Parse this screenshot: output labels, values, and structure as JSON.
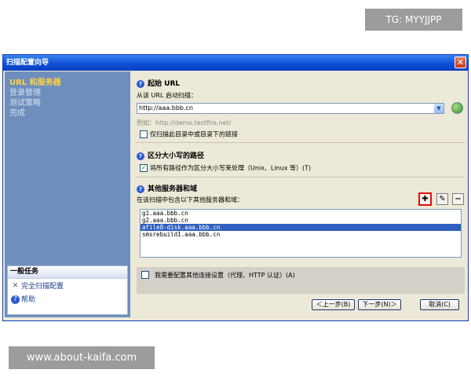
{
  "watermark_top": "TG: MYYJJPP",
  "watermark_bottom": "www.about-kaifa.com",
  "window": {
    "title": "扫描配置向导",
    "close_label": "✕"
  },
  "sidebar": {
    "nav": [
      {
        "label": "URL 和服务器"
      },
      {
        "label": "登录管理"
      },
      {
        "label": "测试策略"
      },
      {
        "label": "完成"
      }
    ],
    "tasks": {
      "header": "一般任务",
      "items": [
        {
          "label": "完全扫描配置",
          "icon": "tools-icon"
        },
        {
          "label": "帮助",
          "icon": "help-icon"
        }
      ]
    }
  },
  "start_url": {
    "title": "起始 URL",
    "prompt": "从该 URL 启动扫描：",
    "value": "http://aaa.bbb.cn",
    "example": "例如：http://demo.testfire.net/",
    "only_below_label": "仅扫描此目录中或目录下的链接",
    "only_below_checked": false
  },
  "case_sensitive": {
    "title": "区分大小写的路径",
    "label": "将所有路径作为区分大小写来处理（Unix、Linux 等）(T)",
    "checked": true
  },
  "other_servers": {
    "title": "其他服务器和域",
    "prompt": "在该扫描中包含以下其他服务器和域：",
    "items": [
      {
        "label": "g1.aaa.bbb.cn",
        "selected": false
      },
      {
        "label": "g2.aaa.bbb.cn",
        "selected": false
      },
      {
        "label": "afile8-disk.aaa.bbb.cn",
        "selected": true
      },
      {
        "label": "smsrebuild1.aaa.bbb.cn",
        "selected": false
      }
    ]
  },
  "extra_settings": {
    "label": "我需要配置其他连接设置（代理、HTTP 认证）(A)",
    "checked": false
  },
  "buttons": {
    "back": "＜上一步(B)",
    "next": "下一步(N)＞",
    "cancel": "取消(C)"
  }
}
